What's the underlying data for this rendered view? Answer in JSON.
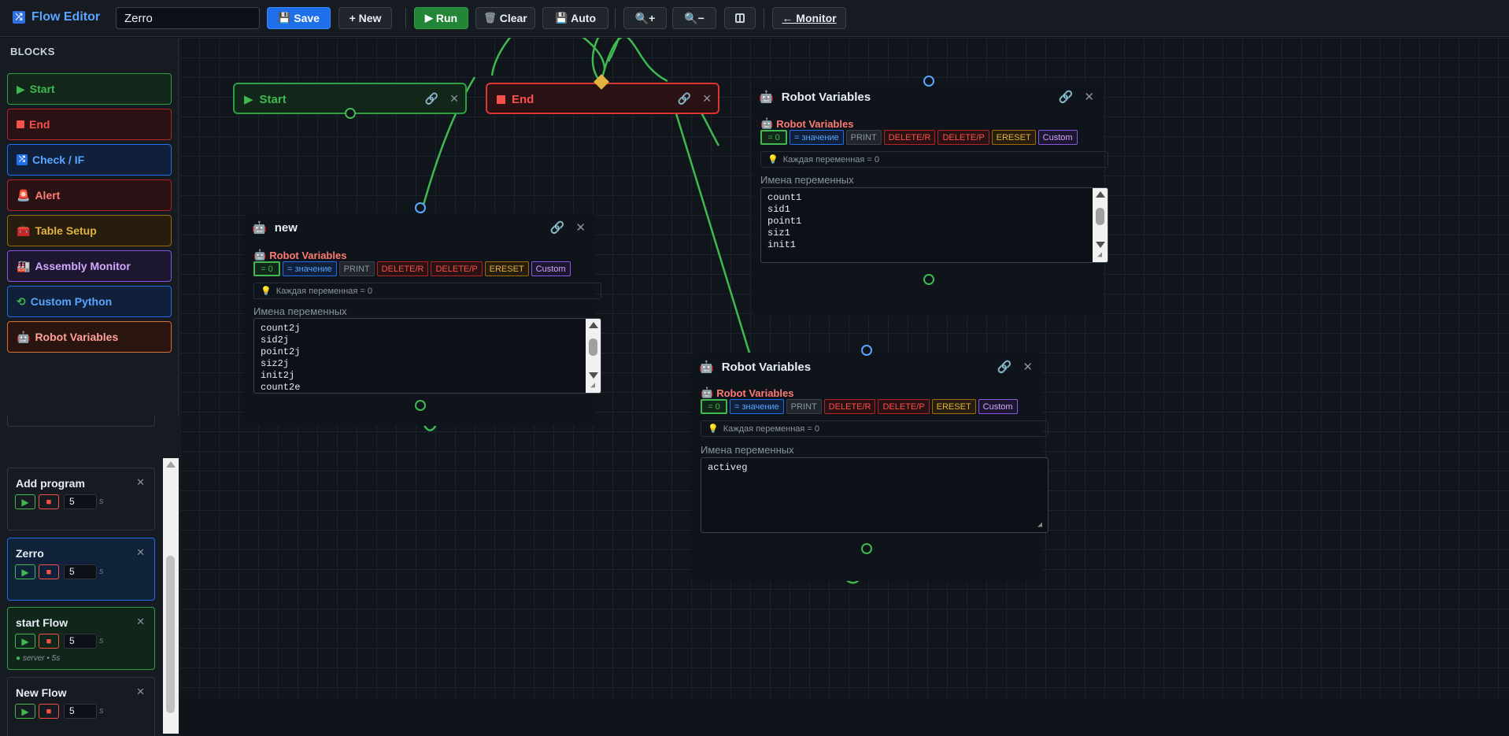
{
  "topbar": {
    "title": "Flow Editor",
    "title_icon": "flow-icon",
    "flow_name": "Zerro",
    "save": "Save",
    "new": "+ New",
    "run": "Run",
    "clear": "Clear",
    "auto": "Auto",
    "zoom_in": "🔍+",
    "zoom_out": "🔍−",
    "monitor": "← Monitor"
  },
  "sidebar": {
    "title": "BLOCKS",
    "blocks": [
      {
        "label": "Start",
        "icon": "play-icon",
        "color": "#3fb950"
      },
      {
        "label": "End",
        "icon": "stop-icon",
        "color": "#f85149"
      },
      {
        "label": "Check / IF",
        "icon": "branch-icon",
        "color": "#58a6ff"
      },
      {
        "label": "Alert",
        "icon": "alarm-icon",
        "color": "#ff7b72"
      },
      {
        "label": "Table Setup",
        "icon": "table-icon",
        "color": "#e3b341"
      },
      {
        "label": "Assembly Monitor",
        "icon": "factory-icon",
        "color": "#d2a8ff"
      },
      {
        "label": "Custom Python",
        "icon": "python-icon",
        "color": "#58a6ff"
      },
      {
        "label": "Robot Variables",
        "icon": "robot-icon",
        "color": "#ffa198"
      }
    ],
    "flows": [
      {
        "name": "Add program",
        "interval": "5",
        "unit": "s"
      },
      {
        "name": "Zerro",
        "interval": "5",
        "unit": "s"
      },
      {
        "name": "start Flow",
        "interval": "5",
        "unit": "s",
        "server": "server • 5s"
      },
      {
        "name": "New Flow",
        "interval": "5",
        "unit": "s"
      }
    ]
  },
  "nodes": {
    "start": {
      "label": "Start"
    },
    "end": {
      "label": "End"
    },
    "rv1": {
      "title": "new",
      "subtitle": "Robot Variables",
      "options": [
        "= 0",
        "= значение",
        "PRINT",
        "DELETE/R",
        "DELETE/P",
        "ERESET",
        "Custom"
      ],
      "hint": "Каждая переменная = 0",
      "label": "Имена переменных",
      "lines": [
        "count2j",
        "sid2j",
        "point2j",
        "siz2j",
        "init2j",
        "count2e"
      ]
    },
    "rv2": {
      "title": "Robot Variables",
      "subtitle": "Robot Variables",
      "options": [
        "= 0",
        "= значение",
        "PRINT",
        "DELETE/R",
        "DELETE/P",
        "ERESET",
        "Custom"
      ],
      "hint": "Каждая переменная = 0",
      "label": "Имена переменных",
      "lines": [
        "count1",
        "sid1",
        "point1",
        "siz1",
        "init1"
      ]
    },
    "rv3": {
      "title": "Robot Variables",
      "subtitle": "Robot Variables",
      "options": [
        "= 0",
        "= значение",
        "PRINT",
        "DELETE/R",
        "DELETE/P",
        "ERESET",
        "Custom"
      ],
      "hint": "Каждая переменная = 0",
      "label": "Имена переменных",
      "lines": [
        "activeg"
      ]
    }
  },
  "colors": {
    "accent": "#58a6ff",
    "green": "#3fb950",
    "red": "#f85149",
    "wire": "#3fb950",
    "yellow": "#e3b341",
    "purple": "#a371f7"
  }
}
